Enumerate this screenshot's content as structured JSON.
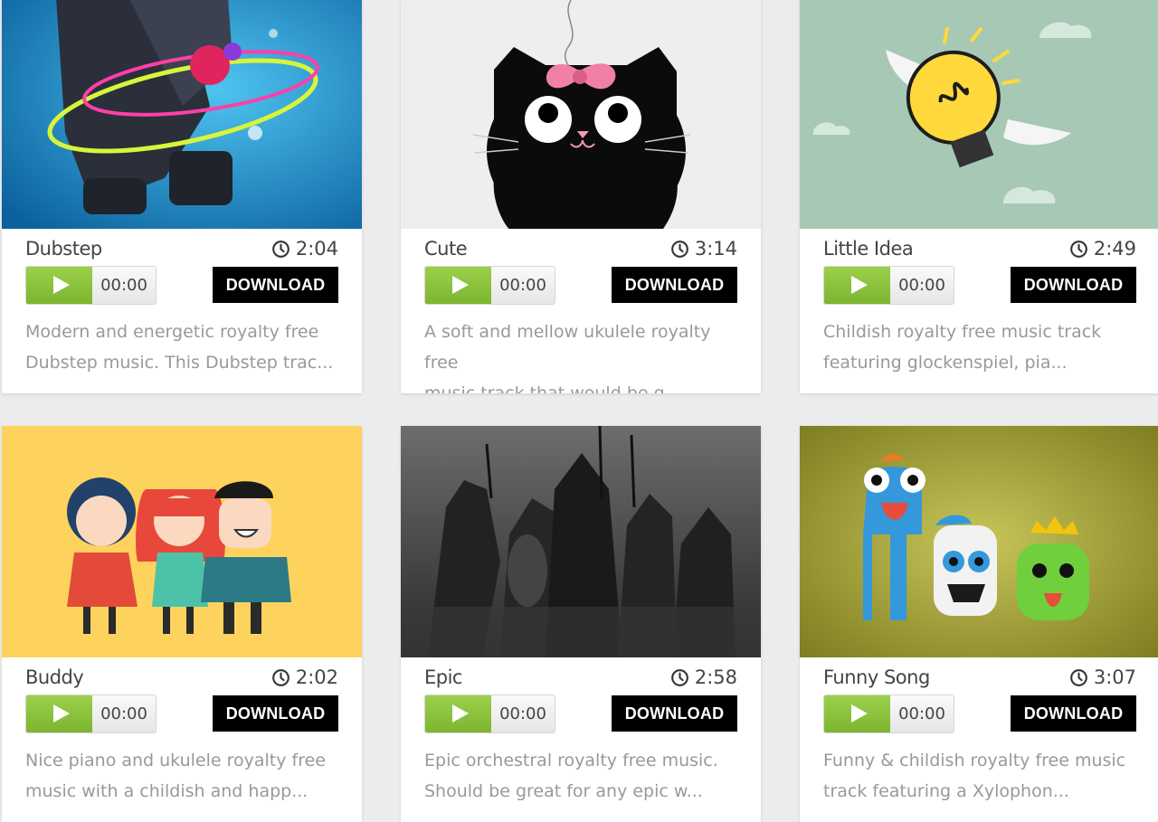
{
  "tracks": [
    {
      "title": "Dubstep",
      "duration": "2:04",
      "time": "00:00",
      "download_label": "DOWNLOAD",
      "description_line1": "Modern and energetic royalty free",
      "description_line2": "Dubstep music. This Dubstep trac..."
    },
    {
      "title": "Cute",
      "duration": "3:14",
      "time": "00:00",
      "download_label": "DOWNLOAD",
      "description_line1": "A soft and mellow ukulele royalty free",
      "description_line2": "music track that would be g..."
    },
    {
      "title": "Little Idea",
      "duration": "2:49",
      "time": "00:00",
      "download_label": "DOWNLOAD",
      "description_line1": "Childish royalty free music track",
      "description_line2": "featuring glockenspiel, pia..."
    },
    {
      "title": "Buddy",
      "duration": "2:02",
      "time": "00:00",
      "download_label": "DOWNLOAD",
      "description_line1": "Nice piano and ukulele royalty free",
      "description_line2": "music with a childish and happ..."
    },
    {
      "title": "Epic",
      "duration": "2:58",
      "time": "00:00",
      "download_label": "DOWNLOAD",
      "description_line1": "Epic orchestral royalty free music.",
      "description_line2": "Should be great for any epic w..."
    },
    {
      "title": "Funny Song",
      "duration": "3:07",
      "time": "00:00",
      "download_label": "DOWNLOAD",
      "description_line1": "Funny & childish royalty free music",
      "description_line2": "track featuring a Xylophon..."
    }
  ],
  "colors": {
    "play": "#8cc63f",
    "download": "#000000",
    "description": "#999999"
  },
  "icons": {
    "duration": "clock-icon",
    "play": "play-icon"
  }
}
